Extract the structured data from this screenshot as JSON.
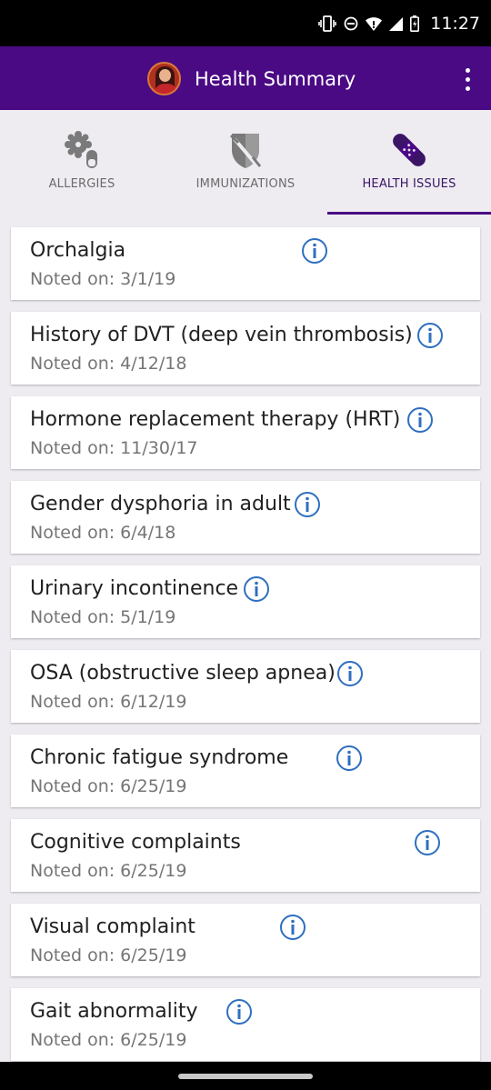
{
  "status_bar": {
    "time": "11:27",
    "icons": [
      "vibrate-icon",
      "do-not-disturb-icon",
      "wifi-icon",
      "cell-signal-icon",
      "battery-icon"
    ]
  },
  "app_bar": {
    "title": "Health Summary",
    "avatar": "profile-avatar",
    "menu_icon": "more-vert-icon",
    "color": "#4a0a84"
  },
  "tabs": [
    {
      "label": "ALLERGIES",
      "icon": "allergies-icon",
      "active": false
    },
    {
      "label": "IMMUNIZATIONS",
      "icon": "immunizations-icon",
      "active": false
    },
    {
      "label": "HEALTH ISSUES",
      "icon": "bandage-icon",
      "active": true
    }
  ],
  "issues": [
    {
      "title": "Orchalgia",
      "date": "Noted on: 3/1/19"
    },
    {
      "title": "History of DVT (deep vein thrombosis)",
      "date": "Noted on: 4/12/18"
    },
    {
      "title": "Hormone replacement therapy (HRT)",
      "date": "Noted on: 11/30/17"
    },
    {
      "title": "Gender dysphoria in adult",
      "date": "Noted on: 6/4/18"
    },
    {
      "title": "Urinary incontinence",
      "date": "Noted on: 5/1/19"
    },
    {
      "title": "OSA (obstructive sleep apnea)",
      "date": "Noted on: 6/12/19"
    },
    {
      "title": "Chronic fatigue syndrome",
      "date": "Noted on: 6/25/19"
    },
    {
      "title": "Cognitive complaints",
      "date": "Noted on: 6/25/19"
    },
    {
      "title": "Visual complaint",
      "date": "Noted on: 6/25/19"
    },
    {
      "title": "Gait abnormality",
      "date": "Noted on: 6/25/19"
    }
  ],
  "colors": {
    "accent": "#4a0a84",
    "info_icon": "#2f6fc0",
    "background": "#eeecf1"
  }
}
